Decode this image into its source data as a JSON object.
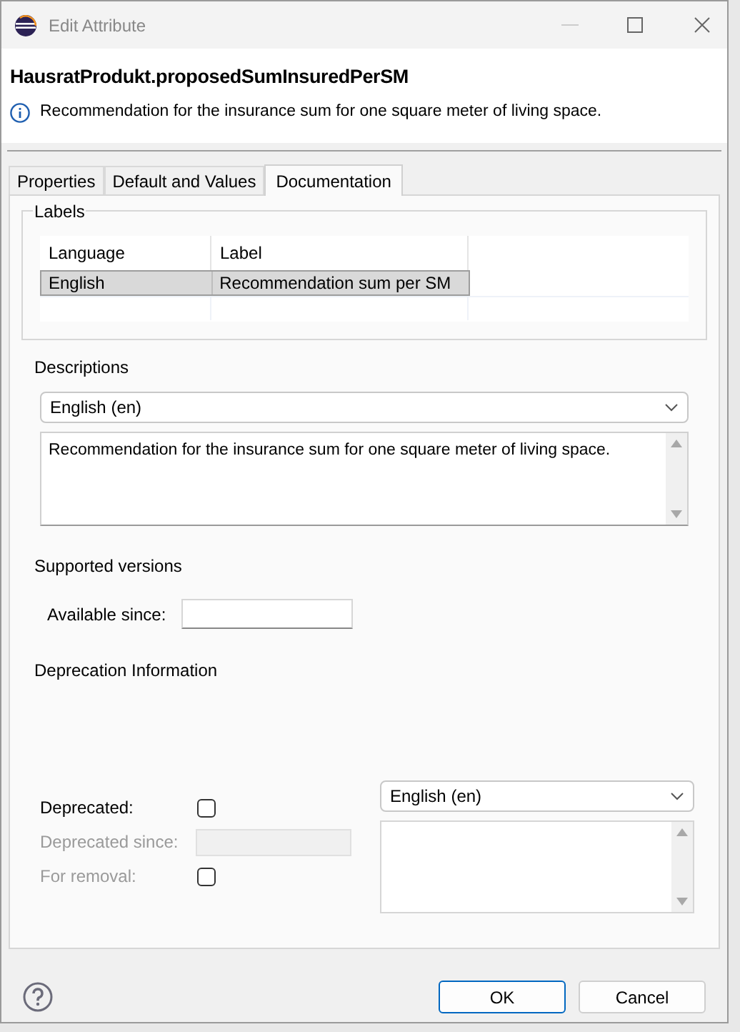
{
  "window": {
    "title": "Edit Attribute"
  },
  "header": {
    "title": "HausratProdukt.proposedSumInsuredPerSM",
    "message": "Recommendation for the insurance sum for one square meter of living space."
  },
  "tabs": [
    {
      "label": "Properties",
      "selected": false
    },
    {
      "label": "Default and Values",
      "selected": false
    },
    {
      "label": "Documentation",
      "selected": true
    }
  ],
  "labels_group": {
    "title": "Labels",
    "columns": [
      "Language",
      "Label"
    ],
    "rows": [
      {
        "language": "English",
        "label": "Recommendation sum per SM",
        "selected": true
      }
    ]
  },
  "descriptions": {
    "label": "Descriptions",
    "language": "English (en)",
    "text": "Recommendation for the insurance sum for one square meter of living space."
  },
  "supported_versions": {
    "heading": "Supported versions",
    "available_since": {
      "label": "Available since:"
    }
  },
  "deprecation": {
    "heading": "Deprecation Information",
    "fields": [
      {
        "kind": "checkbox",
        "label": "Deprecated:",
        "checked": false,
        "disabled": false
      },
      {
        "kind": "text",
        "label": "Deprecated since:",
        "disabled": true
      },
      {
        "kind": "checkbox",
        "label": "For removal:",
        "checked": false,
        "disabled": true
      }
    ],
    "language": "English (en)"
  },
  "buttons": [
    {
      "label": "OK",
      "default": true
    },
    {
      "label": "Cancel",
      "default": false
    }
  ]
}
